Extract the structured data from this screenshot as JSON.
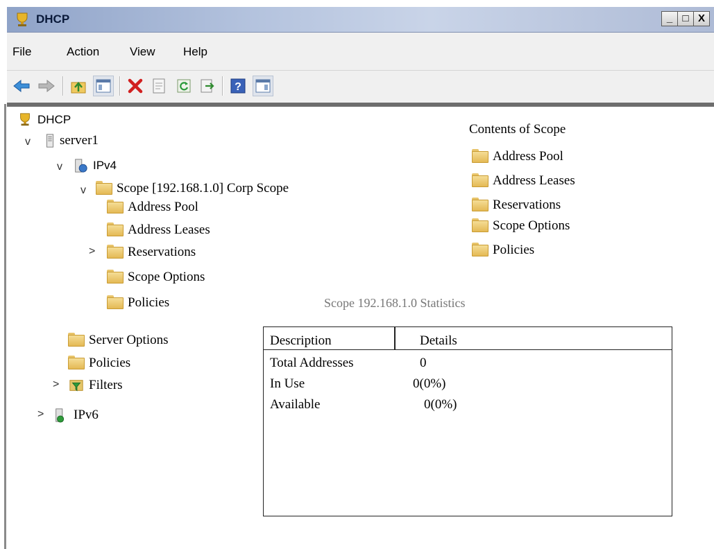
{
  "window": {
    "title": "DHCP",
    "controls": [
      "_",
      "□",
      "X"
    ]
  },
  "menu": {
    "items": [
      "File",
      "Action",
      "View",
      "Help"
    ]
  },
  "toolbar": {
    "buttons": [
      "back-icon",
      "forward-icon",
      "up-folder-icon",
      "show-hide-console-tree-icon",
      "delete-icon",
      "properties-icon",
      "refresh-icon",
      "export-list-icon",
      "help-icon",
      "show-hide-action-pane-icon"
    ]
  },
  "tree": {
    "root": "DHCP",
    "server": "server1",
    "ipv4": "IPv4",
    "scope": "Scope [192.168.1.0] Corp Scope",
    "scope_children": [
      "Address Pool",
      "Address Leases",
      "Reservations",
      "Scope Options",
      "Policies"
    ],
    "server_options": "Server Options",
    "policies": "Policies",
    "filters": "Filters",
    "ipv6": "IPv6",
    "expand_glyph": "v",
    "collapse_glyph": ">"
  },
  "contents": {
    "title": "Contents of Scope",
    "items": [
      "Address Pool",
      "Address Leases",
      "Reservations",
      "Scope Options",
      "Policies"
    ]
  },
  "stats": {
    "title": "Scope 192.168.1.0 Statistics",
    "columns": [
      "Description",
      "Details"
    ],
    "rows": [
      [
        "Total Addresses",
        "0"
      ],
      [
        "In Use",
        "0(0%)"
      ],
      [
        "Available",
        "0(0%)"
      ]
    ]
  }
}
